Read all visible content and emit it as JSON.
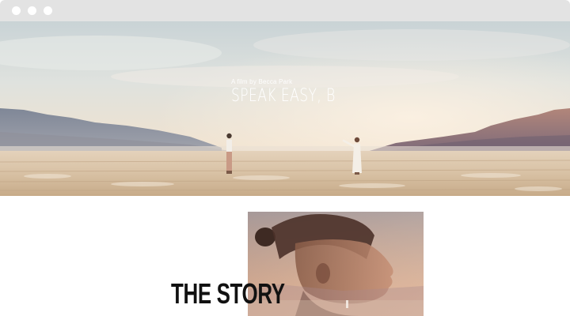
{
  "hero": {
    "subtitle": "A film by Becca Park",
    "title": "SPEAK EASY, B"
  },
  "story": {
    "heading": "THE STORY"
  },
  "icons": {
    "window_controls": [
      "window-dot-icon",
      "window-dot-icon",
      "window-dot-icon"
    ]
  },
  "colors": {
    "titlebar": "#e3e3e3",
    "heading_text": "#111111",
    "hero_text": "#ffffff"
  }
}
